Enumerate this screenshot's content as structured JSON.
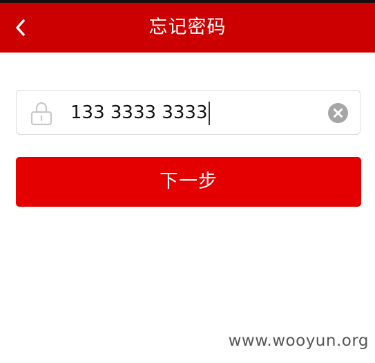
{
  "header": {
    "back_icon": "chevron-left-icon",
    "title": "忘记密码",
    "background": "#cc0000"
  },
  "phone_field": {
    "icon": "lock-icon",
    "value": "133 3333 3333",
    "clear_icon": "clear-icon"
  },
  "next_button": {
    "label": "下一步",
    "color": "#e50000"
  },
  "watermark": {
    "text": "www.wooyun.org"
  }
}
